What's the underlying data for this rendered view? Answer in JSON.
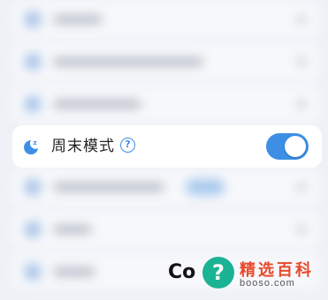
{
  "settings": {
    "weekend_mode": {
      "label": "周末模式",
      "help_glyph": "?",
      "toggle_on": true,
      "icon": "moon-icon"
    }
  },
  "watermark": {
    "fragment": "Co",
    "badge": "?",
    "brand": "精选百科",
    "url": "booso.com"
  },
  "colors": {
    "accent": "#3d8fe6",
    "background": "#eef1f6",
    "watermark_brand": "#e8492b",
    "watermark_badge": "#1ab394"
  }
}
